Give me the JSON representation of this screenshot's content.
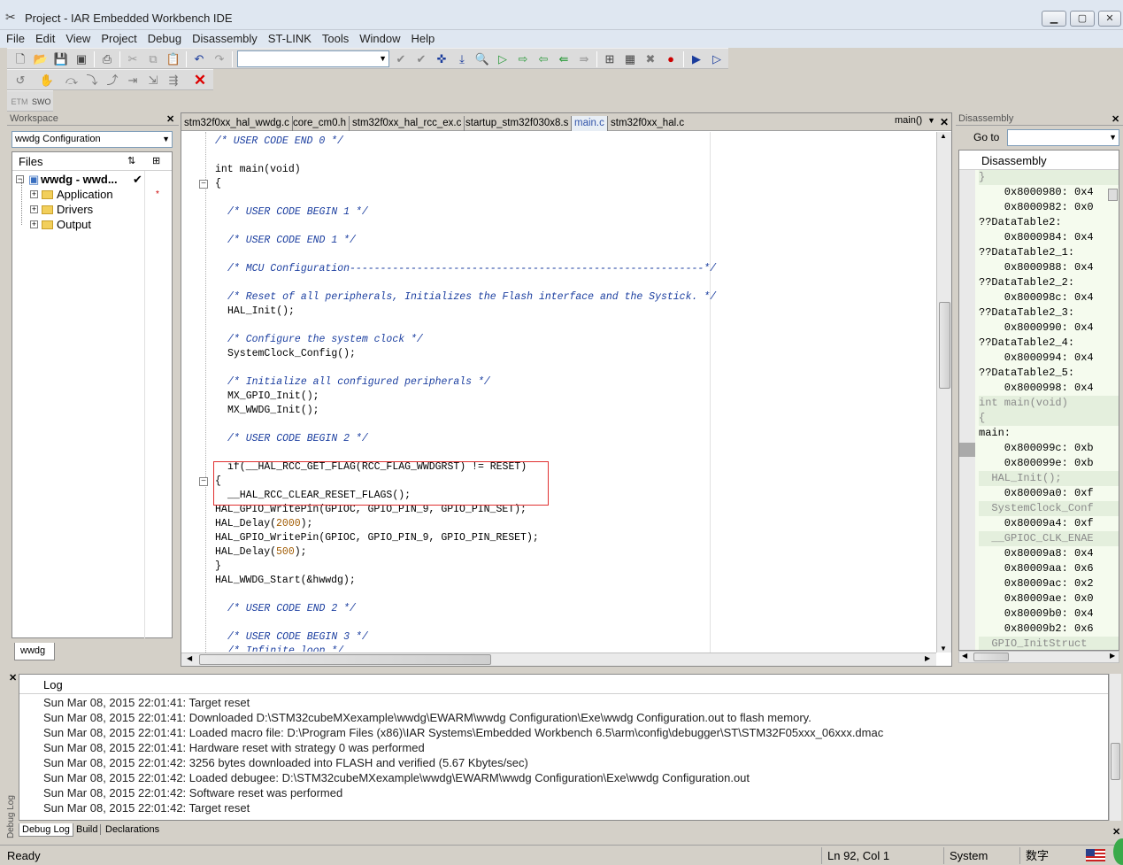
{
  "window": {
    "title": "Project - IAR Embedded Workbench IDE",
    "icons": {
      "app": "iar-tools-icon"
    }
  },
  "menu": [
    "File",
    "Edit",
    "View",
    "Project",
    "Debug",
    "Disassembly",
    "ST-LINK",
    "Tools",
    "Window",
    "Help"
  ],
  "toolbar2": {
    "labels": [
      "ETM",
      "SWO"
    ]
  },
  "workspace": {
    "header": "Workspace",
    "config": "wwdg Configuration",
    "files_label": "Files",
    "tab": "wwdg",
    "tree": [
      {
        "label": "wwdg - wwd...",
        "bold": true,
        "mark": "✔"
      },
      {
        "label": "Application",
        "mark": "*"
      },
      {
        "label": "Drivers",
        "mark": ""
      },
      {
        "label": "Output",
        "mark": ""
      }
    ]
  },
  "editor": {
    "tabs": [
      "stm32f0xx_hal_wwdg.c",
      "core_cm0.h",
      "stm32f0xx_hal_rcc_ex.c",
      "startup_stm32f030x8.s",
      "main.c",
      "stm32f0xx_hal.c"
    ],
    "active_tab": "main.c",
    "func": "main()",
    "lines": [
      {
        "t": "/* USER CODE END 0 */",
        "c": true,
        "i": 0
      },
      {
        "t": "",
        "i": 0
      },
      {
        "t": "int main(void)",
        "i": 0
      },
      {
        "t": "{",
        "i": 0
      },
      {
        "t": "",
        "i": 0
      },
      {
        "t": "/* USER CODE BEGIN 1 */",
        "c": true,
        "i": 1
      },
      {
        "t": "",
        "i": 0
      },
      {
        "t": "/* USER CODE END 1 */",
        "c": true,
        "i": 1
      },
      {
        "t": "",
        "i": 0
      },
      {
        "t": "/* MCU Configuration----------------------------------------------------------*/",
        "c": true,
        "i": 1
      },
      {
        "t": "",
        "i": 0
      },
      {
        "t": "/* Reset of all peripherals, Initializes the Flash interface and the Systick. */",
        "c": true,
        "i": 1
      },
      {
        "t": "HAL_Init();",
        "i": 1
      },
      {
        "t": "",
        "i": 0
      },
      {
        "t": "/* Configure the system clock */",
        "c": true,
        "i": 1
      },
      {
        "t": "SystemClock_Config();",
        "i": 1
      },
      {
        "t": "",
        "i": 0
      },
      {
        "t": "/* Initialize all configured peripherals */",
        "c": true,
        "i": 1
      },
      {
        "t": "MX_GPIO_Init();",
        "i": 1
      },
      {
        "t": "MX_WWDG_Init();",
        "i": 1
      },
      {
        "t": "",
        "i": 0
      },
      {
        "t": "/* USER CODE BEGIN 2 */",
        "c": true,
        "i": 1
      },
      {
        "t": "",
        "i": 0
      },
      {
        "t": "if(__HAL_RCC_GET_FLAG(RCC_FLAG_WWDGRST) != RESET)",
        "i": 1
      },
      {
        "t": "{",
        "i": 0
      },
      {
        "t": "__HAL_RCC_CLEAR_RESET_FLAGS();",
        "i": 1
      },
      {
        "t": "HAL_GPIO_WritePin(GPIOC, GPIO_PIN_9, GPIO_PIN_SET);",
        "i": 0
      },
      {
        "t": "HAL_Delay(",
        "n": "2000",
        "r": ");",
        "i": 0
      },
      {
        "t": "HAL_GPIO_WritePin(GPIOC, GPIO_PIN_9, GPIO_PIN_RESET);",
        "i": 0
      },
      {
        "t": "HAL_Delay(",
        "n": "500",
        "r": ");",
        "i": 0
      },
      {
        "t": "}",
        "i": 0
      },
      {
        "t": "HAL_WWDG_Start(&hwwdg);",
        "i": 0
      },
      {
        "t": "",
        "i": 0
      },
      {
        "t": "/* USER CODE END 2 */",
        "c": true,
        "i": 1
      },
      {
        "t": "",
        "i": 0
      },
      {
        "t": "/* USER CODE BEGIN 3 */",
        "c": true,
        "i": 1
      },
      {
        "t": "/* Infinite loop */",
        "c": true,
        "i": 1
      }
    ]
  },
  "disassembly": {
    "header": "Disassembly",
    "goto_label": "Go to",
    "title": "Disassembly",
    "lines": [
      {
        "t": "}",
        "s": true
      },
      {
        "t": "    0x8000980: 0x4"
      },
      {
        "t": "    0x8000982: 0x0"
      },
      {
        "t": "??DataTable2:"
      },
      {
        "t": "    0x8000984: 0x4"
      },
      {
        "t": "??DataTable2_1:"
      },
      {
        "t": "    0x8000988: 0x4"
      },
      {
        "t": "??DataTable2_2:"
      },
      {
        "t": "    0x800098c: 0x4"
      },
      {
        "t": "??DataTable2_3:"
      },
      {
        "t": "    0x8000990: 0x4"
      },
      {
        "t": "??DataTable2_4:"
      },
      {
        "t": "    0x8000994: 0x4"
      },
      {
        "t": "??DataTable2_5:"
      },
      {
        "t": "    0x8000998: 0x4"
      },
      {
        "t": "int main(void)",
        "s": true
      },
      {
        "t": "{",
        "s": true
      },
      {
        "t": "main:"
      },
      {
        "t": "    0x800099c: 0xb"
      },
      {
        "t": "    0x800099e: 0xb"
      },
      {
        "t": "  HAL_Init();",
        "s": true
      },
      {
        "t": "    0x80009a0: 0xf"
      },
      {
        "t": "  SystemClock_Conf",
        "s": true
      },
      {
        "t": "    0x80009a4: 0xf"
      },
      {
        "t": "  __GPIOC_CLK_ENAE",
        "s": true
      },
      {
        "t": "    0x80009a8: 0x4"
      },
      {
        "t": "    0x80009aa: 0x6"
      },
      {
        "t": "    0x80009ac: 0x2"
      },
      {
        "t": "    0x80009ae: 0x0"
      },
      {
        "t": "    0x80009b0: 0x4"
      },
      {
        "t": "    0x80009b2: 0x6"
      },
      {
        "t": "  GPIO_InitStruct",
        "s": true
      }
    ]
  },
  "log": {
    "header": "Log",
    "side_label": "Debug Log",
    "lines": [
      "Sun Mar 08, 2015 22:01:41: Target reset",
      "Sun Mar 08, 2015 22:01:41: Downloaded D:\\STM32cubeMXexample\\wwdg\\EWARM\\wwdg Configuration\\Exe\\wwdg Configuration.out to flash memory.",
      "Sun Mar 08, 2015 22:01:41: Loaded macro file: D:\\Program Files (x86)\\IAR Systems\\Embedded Workbench 6.5\\arm\\config\\debugger\\ST\\STM32F05xxx_06xxx.dmac",
      "Sun Mar 08, 2015 22:01:41: Hardware reset with strategy 0 was performed",
      "Sun Mar 08, 2015 22:01:42: 3256 bytes downloaded into FLASH and verified (5.67 Kbytes/sec)",
      "Sun Mar 08, 2015 22:01:42: Loaded debugee: D:\\STM32cubeMXexample\\wwdg\\EWARM\\wwdg Configuration\\Exe\\wwdg Configuration.out",
      "Sun Mar 08, 2015 22:01:42: Software reset was performed",
      "Sun Mar 08, 2015 22:01:42: Target reset"
    ],
    "tabs": [
      "Debug Log",
      "Build",
      "Declarations"
    ]
  },
  "status": {
    "ready": "Ready",
    "position": "Ln 92, Col 1",
    "mode": "System",
    "ime": "数字"
  },
  "colors": {
    "highlight_box": "#e03030",
    "comment": "#1c3fa0",
    "number": "#a05a00"
  }
}
